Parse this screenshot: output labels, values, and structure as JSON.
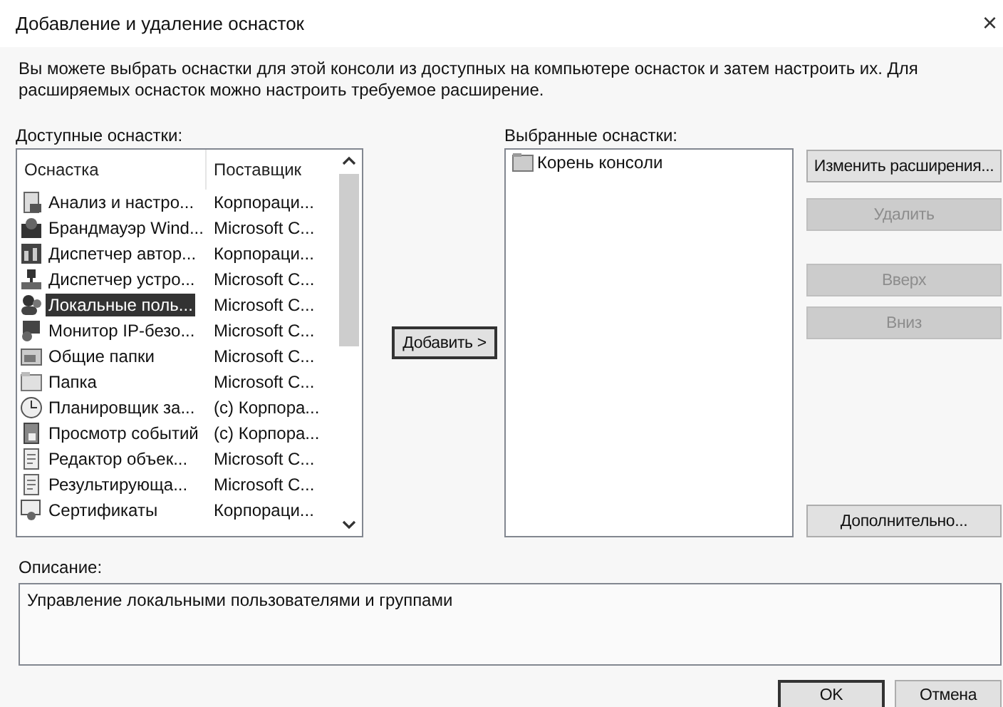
{
  "window": {
    "title": "Добавление и удаление оснасток",
    "close": "×"
  },
  "intro": "Вы можете выбрать оснастки для этой консоли из доступных на компьютере оснасток и затем настроить их. Для расширяемых оснасток можно настроить требуемое расширение.",
  "available": {
    "label": "Доступные оснастки:",
    "columns": [
      "Оснастка",
      "Поставщик"
    ],
    "rows": [
      {
        "name": "Анализ и настро...",
        "vendor": "Корпораци...",
        "selected": false
      },
      {
        "name": "Брандмауэр Wind...",
        "vendor": "Microsoft C...",
        "selected": false
      },
      {
        "name": "Диспетчер автор...",
        "vendor": "Корпораци...",
        "selected": false
      },
      {
        "name": "Диспетчер устро...",
        "vendor": "Microsoft C...",
        "selected": false
      },
      {
        "name": "Локальные поль...",
        "vendor": "Microsoft C...",
        "selected": true
      },
      {
        "name": "Монитор IP-безо...",
        "vendor": "Microsoft C...",
        "selected": false
      },
      {
        "name": "Общие папки",
        "vendor": "Microsoft C...",
        "selected": false
      },
      {
        "name": "Папка",
        "vendor": "Microsoft C...",
        "selected": false
      },
      {
        "name": "Планировщик за...",
        "vendor": "(c) Корпора...",
        "selected": false
      },
      {
        "name": "Просмотр событий",
        "vendor": "(c) Корпора...",
        "selected": false
      },
      {
        "name": "Редактор объек...",
        "vendor": "Microsoft C...",
        "selected": false
      },
      {
        "name": "Результирующа...",
        "vendor": "Microsoft C...",
        "selected": false
      },
      {
        "name": "Сертификаты",
        "vendor": "Корпораци...",
        "selected": false
      }
    ]
  },
  "add_button": {
    "label": "Добавить >",
    "focused": true
  },
  "selected": {
    "label": "Выбранные оснастки:",
    "items": [
      {
        "name": "Корень консоли"
      }
    ]
  },
  "side_buttons": [
    {
      "label": "Изменить расширения...",
      "disabled": false
    },
    {
      "label": "Удалить",
      "disabled": true
    },
    {
      "label": "Вверх",
      "disabled": true
    },
    {
      "label": "Вниз",
      "disabled": true
    },
    {
      "label": "Дополнительно...",
      "disabled": false
    }
  ],
  "description": {
    "label": "Описание:",
    "text": "Управление локальными пользователями и группами"
  },
  "buttons": [
    {
      "label": "OK",
      "default": true
    },
    {
      "label": "Отмена",
      "default": false
    }
  ]
}
